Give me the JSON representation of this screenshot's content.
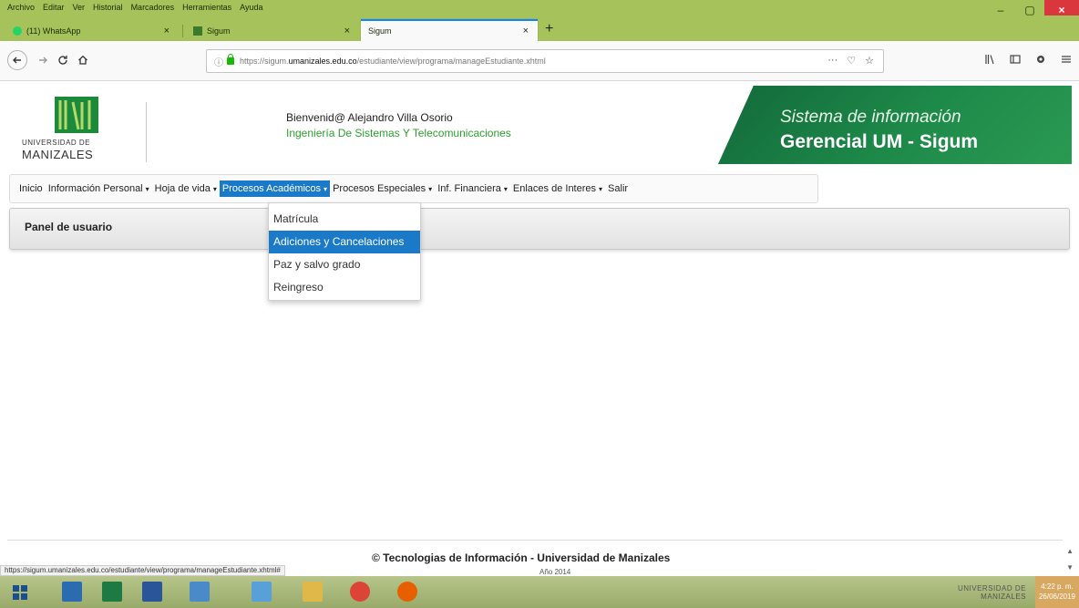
{
  "browser": {
    "menu": [
      "Archivo",
      "Editar",
      "Ver",
      "Historial",
      "Marcadores",
      "Herramientas",
      "Ayuda"
    ],
    "tabs": [
      {
        "title": "(11) WhatsApp",
        "close": "×"
      },
      {
        "title": "Sigum",
        "close": "×"
      },
      {
        "title": "Sigum",
        "close": "×"
      }
    ],
    "new_tab": "+",
    "url": {
      "prefix": "https://sigum.",
      "domain": "umanizales.edu.co",
      "path": "/estudiante/view/programa/manageEstudiante.xhtml"
    },
    "url_actions": [
      "···",
      "♡",
      "☆"
    ],
    "window_controls": [
      "–",
      "▢",
      "×"
    ],
    "status_url": "https://sigum.umanizales.edu.co/estudiante/view/programa/manageEstudiante.xhtml#"
  },
  "header": {
    "logo_line1": "UNIVERSIDAD DE",
    "logo_line2": "MANIZALES",
    "welcome": "Bienvenid@ Alejandro Villa Osorio",
    "program": "Ingeniería De Sistemas Y Telecomunicaciones",
    "banner_line1": "Sistema de información",
    "banner_line2": "Gerencial UM - Sigum"
  },
  "menu": {
    "items": [
      {
        "label": "Inicio",
        "caret": ""
      },
      {
        "label": "Información Personal",
        "caret": "▾"
      },
      {
        "label": "Hoja de vida",
        "caret": "▾"
      },
      {
        "label": "Procesos Académicos",
        "caret": "▾"
      },
      {
        "label": "Procesos Especiales",
        "caret": "▾"
      },
      {
        "label": "Inf. Financiera",
        "caret": "▾"
      },
      {
        "label": "Enlaces de Interes",
        "caret": "▾"
      },
      {
        "label": "Salir",
        "caret": ""
      }
    ],
    "dropdown": [
      "Matrícula",
      "Adiciones y Cancelaciones",
      "Paz y salvo grado",
      "Reingreso"
    ]
  },
  "panel": {
    "title": "Panel de usuario"
  },
  "footer": {
    "text": "© Tecnologias de Información - Universidad de Manizales",
    "year": "Año 2014"
  },
  "taskbar": {
    "tray_logo1": "UNIVERSIDAD DE",
    "tray_logo2": "MANIZALES",
    "time": "4:22 p. m.",
    "date": "26/06/2019"
  },
  "colors": {
    "browser_chrome": "#a5c35a",
    "menu_active": "#1b7ac7",
    "program_text": "#2e9e2e",
    "banner": "#1e8a4a"
  }
}
